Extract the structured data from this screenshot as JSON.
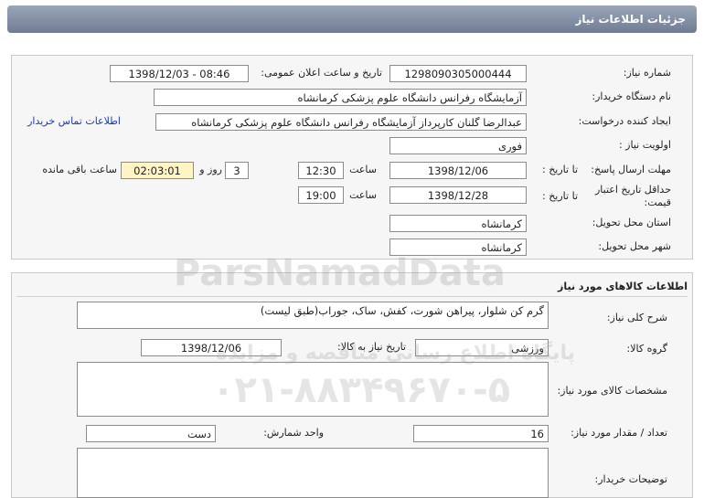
{
  "header": {
    "title": "جزئیات اطلاعات نیاز"
  },
  "details": {
    "need_number": {
      "label": "شماره نیاز:",
      "value": "1298090305000444"
    },
    "announce": {
      "label": "تاریخ و ساعت اعلان عمومی:",
      "value": "1398/12/03 - 08:46"
    },
    "buyer_org": {
      "label": "نام دستگاه خریدار:",
      "value": "آزمایشگاه رفرانس دانشگاه علوم پزشکی کرمانشاه"
    },
    "requester": {
      "label": "ایجاد کننده درخواست:",
      "value": "عبدالرضا گلنان کارپرداز آزمایشگاه رفرانس دانشگاه علوم پزشکی کرمانشاه",
      "contact_link": "اطلاعات تماس خریدار"
    },
    "priority": {
      "label": "اولویت نیاز :",
      "value": "فوری"
    },
    "deadline": {
      "label": "مهلت ارسال پاسخ:",
      "to_date_label": "تا تاریخ :",
      "date": "1398/12/06",
      "time_label": "ساعت",
      "time": "12:30",
      "days": "3",
      "days_label": "روز و",
      "remaining": "02:03:01",
      "remaining_label": "ساعت باقی مانده"
    },
    "validity": {
      "label": "حداقل تاریخ اعتبار قیمت:",
      "to_date_label": "تا تاریخ :",
      "date": "1398/12/28",
      "time_label": "ساعت",
      "time": "19:00"
    },
    "province": {
      "label": "استان محل تحویل:",
      "value": "کرمانشاه"
    },
    "city": {
      "label": "شهر محل تحویل:",
      "value": "کرمانشاه"
    }
  },
  "goods": {
    "title": "اطلاعات کالاهای مورد نیاز",
    "summary_label": "شرح کلی نیاز:",
    "summary": "گرم کن شلوار، پیراهن شورت، کفش، ساک، جوراب(طبق لیست)",
    "group_label": "گروه کالا:",
    "group": "ورزشی",
    "need_date_label": "تاریخ نیاز به کالا:",
    "need_date": "1398/12/06",
    "specs_label": "مشخصات کالای مورد نیاز:",
    "specs": "",
    "quantity_label": "تعداد / مقدار مورد نیاز:",
    "quantity": "16",
    "unit_label": "واحد شمارش:",
    "unit": "دست",
    "buyer_notes_label": "توضیحات خریدار:",
    "buyer_notes": ""
  },
  "watermark": {
    "brand": "ParsNamadData",
    "line1": "پایگاه اطلاع رسانی مناقصه و مزایده",
    "phone": "۰۲۱-۸۸۳۴۹۶۷۰-۵"
  }
}
